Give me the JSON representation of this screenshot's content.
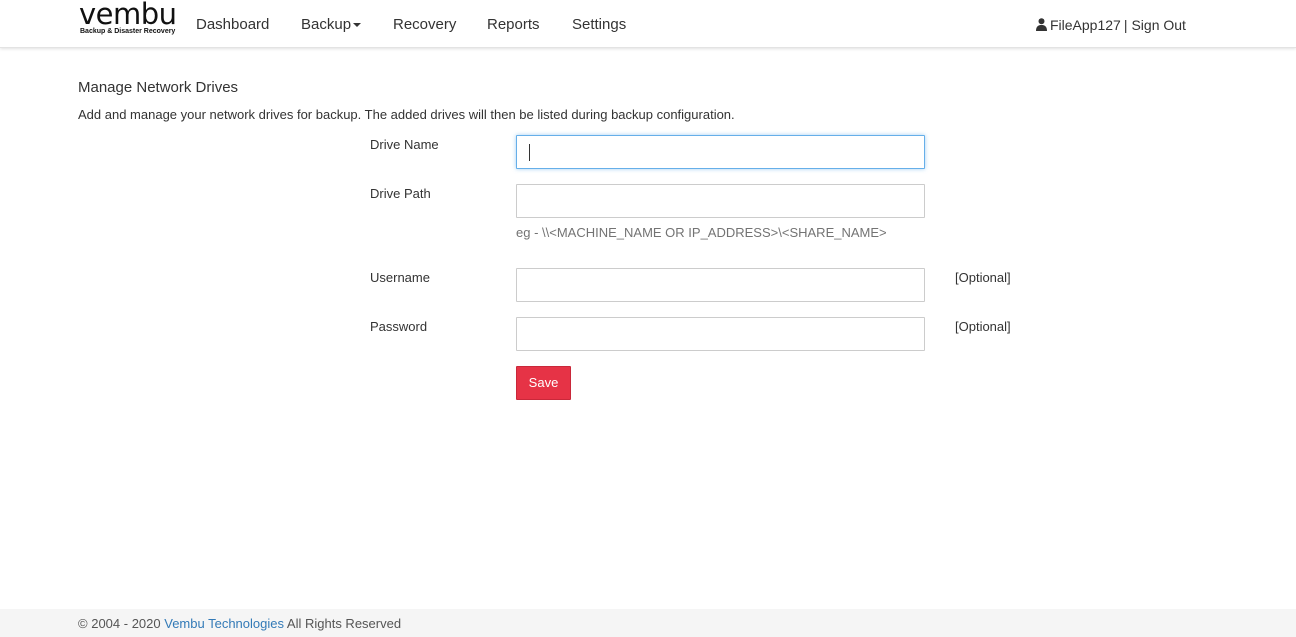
{
  "brand": {
    "logo_text": "vembu",
    "tagline": "Backup & Disaster Recovery"
  },
  "nav": {
    "items": [
      {
        "label": "Dashboard"
      },
      {
        "label": "Backup"
      },
      {
        "label": "Recovery"
      },
      {
        "label": "Reports"
      },
      {
        "label": "Settings"
      }
    ]
  },
  "user": {
    "icon": "user-icon",
    "name": "FileApp127",
    "separator": "|",
    "sign_out": "Sign Out"
  },
  "page": {
    "title": "Manage Network Drives",
    "description": "Add and manage your network drives for backup. The added drives will then be listed during backup configuration."
  },
  "form": {
    "drive_name": {
      "label": "Drive Name",
      "value": ""
    },
    "drive_path": {
      "label": "Drive Path",
      "value": "",
      "help": "eg - \\\\<MACHINE_NAME OR IP_ADDRESS>\\<SHARE_NAME>"
    },
    "username": {
      "label": "Username",
      "value": "",
      "note": "[Optional]"
    },
    "password": {
      "label": "Password",
      "value": "",
      "note": "[Optional]"
    },
    "save_label": "Save"
  },
  "footer": {
    "copyright_symbol": "©",
    "years": "2004 - 2020",
    "company": "Vembu Technologies",
    "rights": "All Rights Reserved"
  },
  "colors": {
    "primary_button": "#e63346",
    "link": "#337ab7",
    "focus": "#66afe9",
    "footer_bg": "#f5f5f5"
  }
}
